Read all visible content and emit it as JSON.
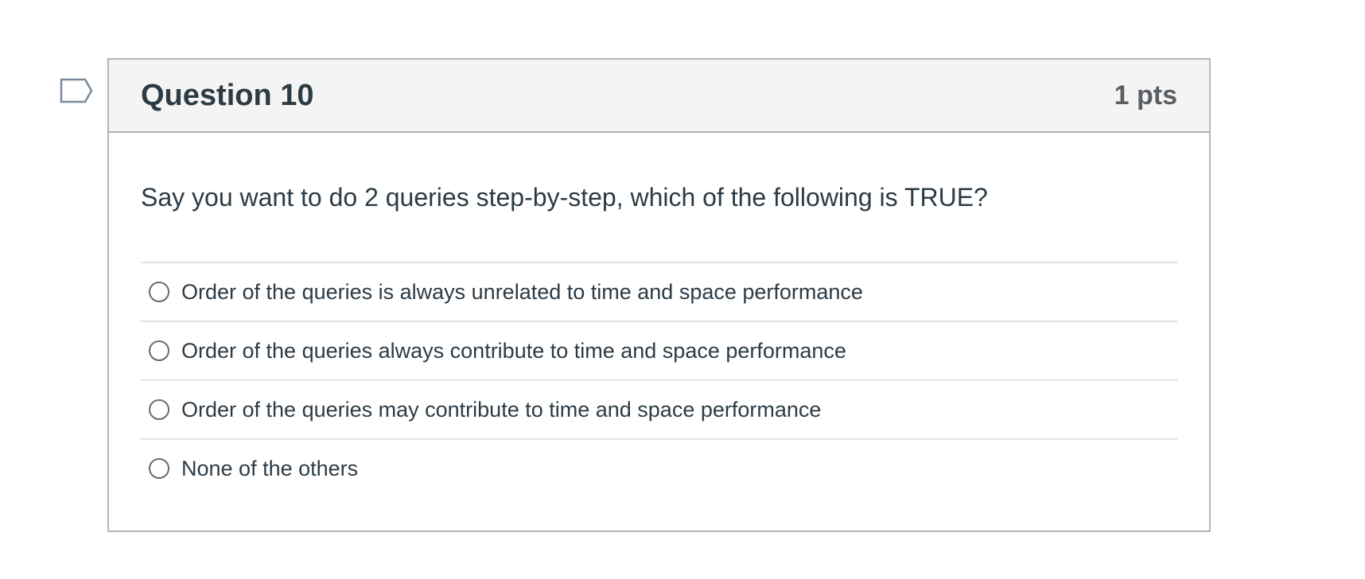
{
  "question": {
    "title": "Question 10",
    "points": "1 pts",
    "text": "Say you want to do 2 queries step-by-step, which of the following is TRUE?",
    "flag_icon": "flag-icon"
  },
  "answers": [
    {
      "label": "Order of the queries is always unrelated to time and space performance",
      "selected": false
    },
    {
      "label": "Order of the queries always contribute to time and space performance",
      "selected": false
    },
    {
      "label": "Order of the queries may contribute to time and space performance",
      "selected": false
    },
    {
      "label": "None of the others",
      "selected": false
    }
  ],
  "colors": {
    "header_background": "#f4f4f4",
    "border": "#b5b5b5",
    "divider": "#e2e2e2",
    "text": "#2d3b45",
    "points_text": "#5a5f63",
    "flag_stroke": "#7a8a99"
  }
}
